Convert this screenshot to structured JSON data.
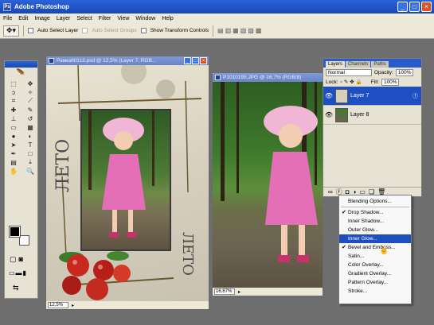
{
  "app": {
    "title": "Adobe Photoshop"
  },
  "menu": [
    "File",
    "Edit",
    "Image",
    "Layer",
    "Select",
    "Filter",
    "View",
    "Window",
    "Help"
  ],
  "options": {
    "auto_select_layer": "Auto Select Layer",
    "auto_select_groups": "Auto Select Groups",
    "show_transform_controls": "Show Transform Controls"
  },
  "doc1": {
    "title": "РамкаNf113.psd @ 12,5% (Layer 7, RGB...",
    "zoom": "12,5%",
    "frame_text": "ЛЕТО"
  },
  "doc2": {
    "title": "P1010195.JPG @ 16,7% (RGB/8)",
    "zoom": "16,67%"
  },
  "layers_panel": {
    "tabs": [
      "Layers",
      "Channels",
      "Paths"
    ],
    "blend_mode": "Normal",
    "opacity_label": "Opacity:",
    "opacity": "100%",
    "lock_label": "Lock:",
    "fill_label": "Fill:",
    "fill": "100%",
    "layers": [
      {
        "name": "Layer 7",
        "selected": true
      },
      {
        "name": "Layer 8",
        "selected": false
      }
    ]
  },
  "style_menu": {
    "items": [
      {
        "label": "Blending Options..."
      },
      {
        "label": "Drop Shadow...",
        "checked": true
      },
      {
        "label": "Inner Shadow..."
      },
      {
        "label": "Outer Glow..."
      },
      {
        "label": "Inner Glow...",
        "highlighted": true
      },
      {
        "label": "Bevel and Emboss...",
        "checked": true
      },
      {
        "label": "Satin..."
      },
      {
        "label": "Color Overlay..."
      },
      {
        "label": "Gradient Overlay..."
      },
      {
        "label": "Pattern Overlay..."
      },
      {
        "label": "Stroke..."
      }
    ]
  },
  "colors": {
    "title_bar": "#1f55c9",
    "chrome": "#ece9d8",
    "workspace": "#6e6e6e",
    "selection": "#1e4fc2"
  }
}
